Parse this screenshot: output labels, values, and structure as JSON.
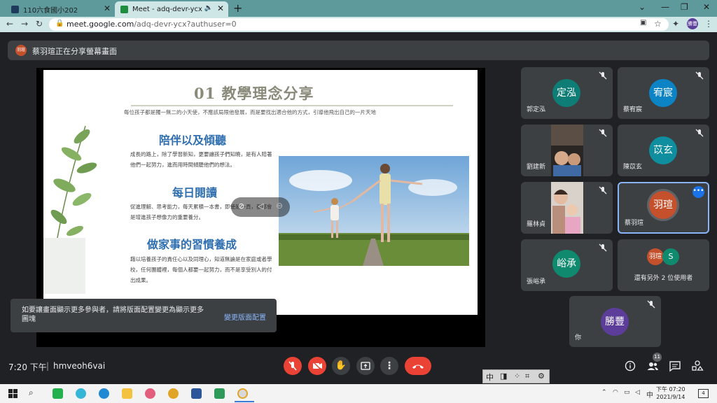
{
  "browser": {
    "tabs": [
      {
        "label": "110六食國小202"
      },
      {
        "label": "Meet - adq-devr-ycx"
      }
    ],
    "url_host": "meet.google.com",
    "url_path": "/adq-devr-ycx?authuser=0",
    "profile_initials": "勝豐"
  },
  "banner": {
    "avatar_initials": "羽瑄",
    "text": "蔡羽瑄正在分享螢幕畫面"
  },
  "slide": {
    "title": "01 教學理念分享",
    "intro": "每位孩子都是獨一無二的小天使，不應該局限他發展，而是要找出適合他的方式，引導他飛出自己的一片天地",
    "sections": [
      {
        "heading": "陪伴以及傾聽",
        "body": "成長的路上，除了學習新知，更要讓孩子們知曉，是有人陪著他們一起努力，進而用時間傾聽他們的想法。"
      },
      {
        "heading": "每日閱讀",
        "body": "促進理解、思考能力，每天累積一本書，即使是一頁，都都會是增進孩子想像力的重要養分。"
      },
      {
        "heading": "做家事的習慣養成",
        "body": "藉以培養孩子的責任心以及同理心，知道無論是在家庭或者學校，任何團體裡，每個人都要一起努力，而不是享受別人的付出成果。"
      }
    ]
  },
  "toast": {
    "message": "如要讓畫面顯示更多參與者，請將版面配置變更為顯示更多圖塊",
    "action_label": "變更版面配置"
  },
  "participants": [
    {
      "name": "郭定泓",
      "initials": "定泓",
      "color": "#0e7d75",
      "video": false
    },
    {
      "name": "蔡宥宸",
      "initials": "宥宸",
      "color": "#0b83c4",
      "video": false
    },
    {
      "name": "劉建新",
      "initials": "",
      "color": "",
      "video": true
    },
    {
      "name": "陳苡玄",
      "initials": "苡玄",
      "color": "#0e8e9e",
      "video": false
    },
    {
      "name": "羅林貞",
      "initials": "",
      "color": "",
      "video": true
    },
    {
      "name": "蔡羽瑄",
      "initials": "羽瑄",
      "color": "#c5502c",
      "video": false
    },
    {
      "name": "張峪承",
      "initials": "峪承",
      "color": "#0f8a6f",
      "video": false
    },
    {
      "name": "你",
      "initials": "勝豐",
      "color": "#5c3e9a",
      "video": false
    }
  ],
  "others": {
    "label": "還有另外 2 位使用者",
    "avatar1": "羽瑄",
    "avatar2": "S"
  },
  "bottom": {
    "time": "7:20 下午",
    "meeting_code": "hmveoh6vai",
    "participant_count": "11"
  },
  "ime": {
    "mode": "中"
  },
  "taskbar": {
    "clock_time": "下午 07:20",
    "clock_date": "2021/9/14",
    "lang": "中",
    "notifications": "4"
  },
  "colors": {
    "accent_red": "#ea4335",
    "slide_heading": "#2f6fb0",
    "tab_bar": "#5e9a9b"
  }
}
